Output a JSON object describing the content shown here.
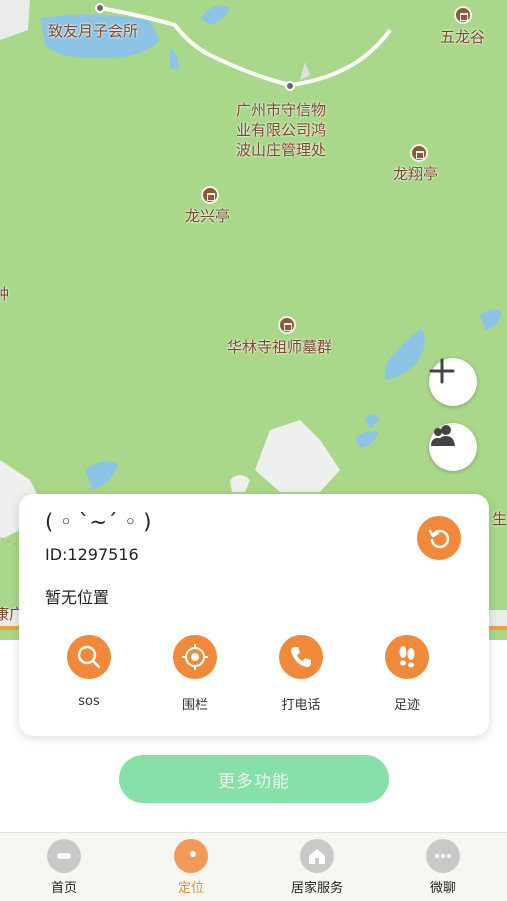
{
  "map": {
    "pois": [
      {
        "label": "致友月子会所"
      },
      {
        "label": "五龙谷"
      },
      {
        "label": "广州市守信物\n业有限公司鸿\n波山庄管理处"
      },
      {
        "label": "龙翔亭"
      },
      {
        "label": "龙兴亭"
      },
      {
        "label": "华林寺祖师墓群"
      },
      {
        "label": "钟"
      },
      {
        "label": "生"
      },
      {
        "label": "康广"
      }
    ],
    "zoom_in_icon": "plus-icon",
    "people_icon": "people-icon"
  },
  "device": {
    "name": "( ◦ `~´ ◦ )",
    "id_text": "ID:1297516",
    "location_text": "暂无位置"
  },
  "actions": [
    {
      "label": "sos",
      "icon": "search-icon"
    },
    {
      "label": "围栏",
      "icon": "target-icon"
    },
    {
      "label": "打电话",
      "icon": "phone-icon"
    },
    {
      "label": "足迹",
      "icon": "footprints-icon"
    }
  ],
  "more_button": "更多功能",
  "tabs": [
    {
      "label": "首页",
      "icon": "home-icon"
    },
    {
      "label": "定位",
      "icon": "location-icon"
    },
    {
      "label": "居家服务",
      "icon": "house-icon"
    },
    {
      "label": "微聊",
      "icon": "chat-icon"
    }
  ],
  "colors": {
    "accent": "#f08a3a",
    "map_green": "#a9d88a",
    "water": "#8cc4e6",
    "more_button": "#86e0a8"
  }
}
